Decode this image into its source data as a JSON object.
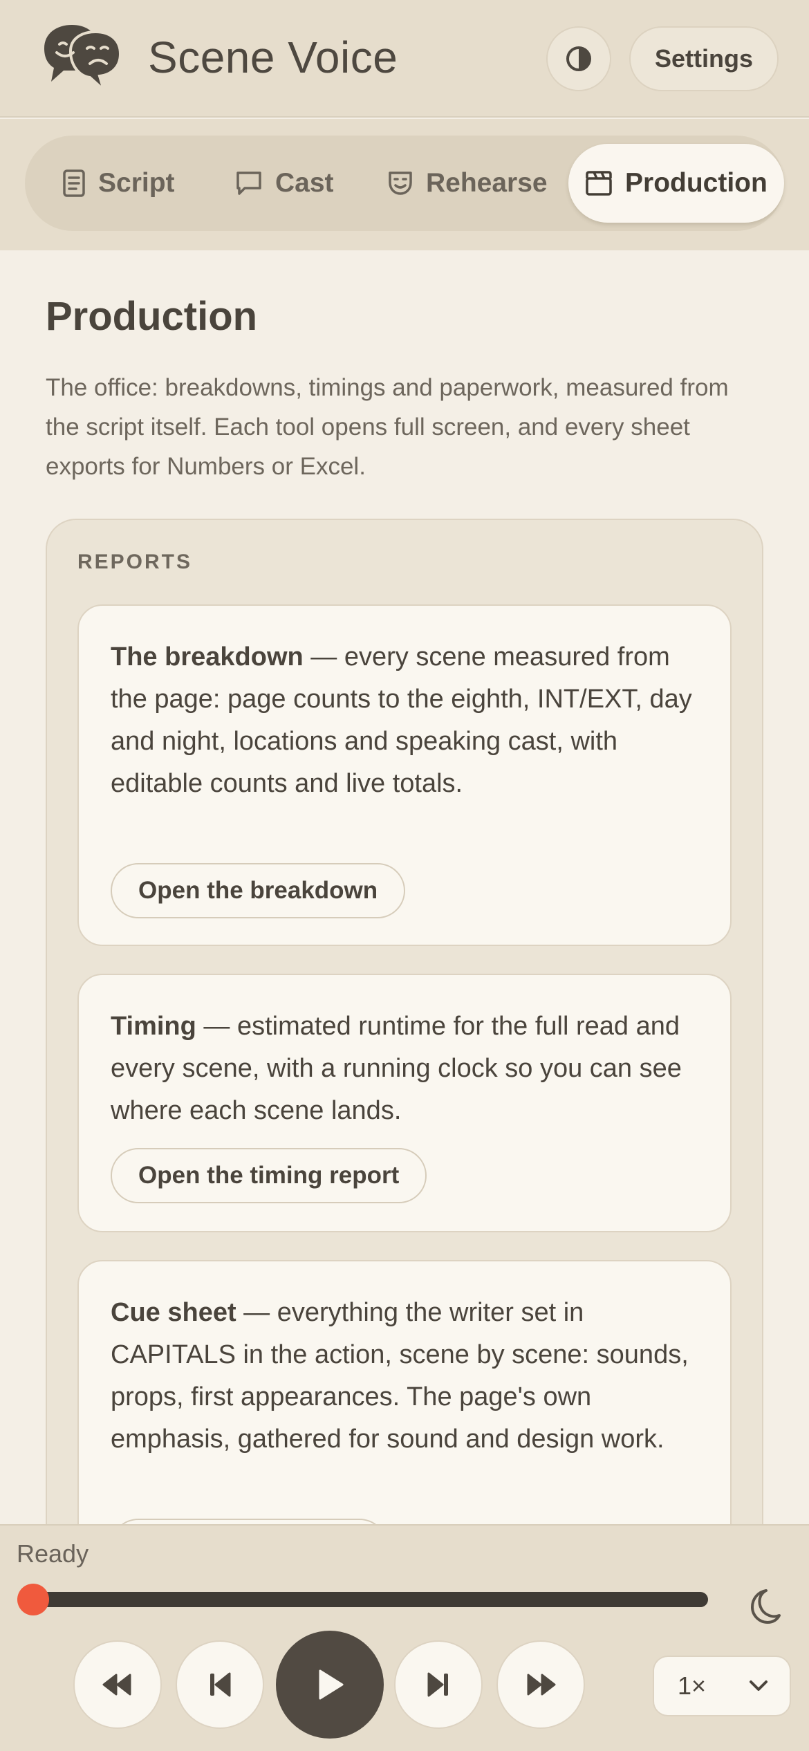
{
  "app": {
    "title": "Scene Voice"
  },
  "header": {
    "settings_label": "Settings",
    "theme_icon": "contrast-icon"
  },
  "tabs": [
    {
      "label": "Script",
      "icon": "document-icon",
      "active": false
    },
    {
      "label": "Cast",
      "icon": "speech-bubble-icon",
      "active": false
    },
    {
      "label": "Rehearse",
      "icon": "mask-icon",
      "active": false
    },
    {
      "label": "Production",
      "icon": "clapperboard-icon",
      "active": true
    }
  ],
  "main": {
    "title": "Production",
    "description": "The office: breakdowns, timings and paperwork, measured from the script itself. Each tool opens full screen, and every sheet exports for Numbers or Excel.",
    "reports_label": "REPORTS",
    "cards": [
      {
        "heading": "The breakdown",
        "body": " — every scene measured from the page: page counts to the eighth, INT/EXT, day and night, locations and speaking cast, with editable counts and live totals.",
        "button": "Open the breakdown"
      },
      {
        "heading": "Timing",
        "body": " — estimated runtime for the full read and every scene, with a running clock so you can see where each scene lands.",
        "button": "Open the timing report"
      },
      {
        "heading": "Cue sheet",
        "body": " — everything the writer set in CAPITALS in the action, scene by scene: sounds, props, first appearances. The page's own emphasis, gathered for sound and design work.",
        "button": ""
      }
    ]
  },
  "player": {
    "status": "Ready",
    "progress": 0,
    "speed": "1×",
    "colors": {
      "accent": "#f05a3d",
      "track": "#3f3a34",
      "play": "#514a42"
    }
  }
}
